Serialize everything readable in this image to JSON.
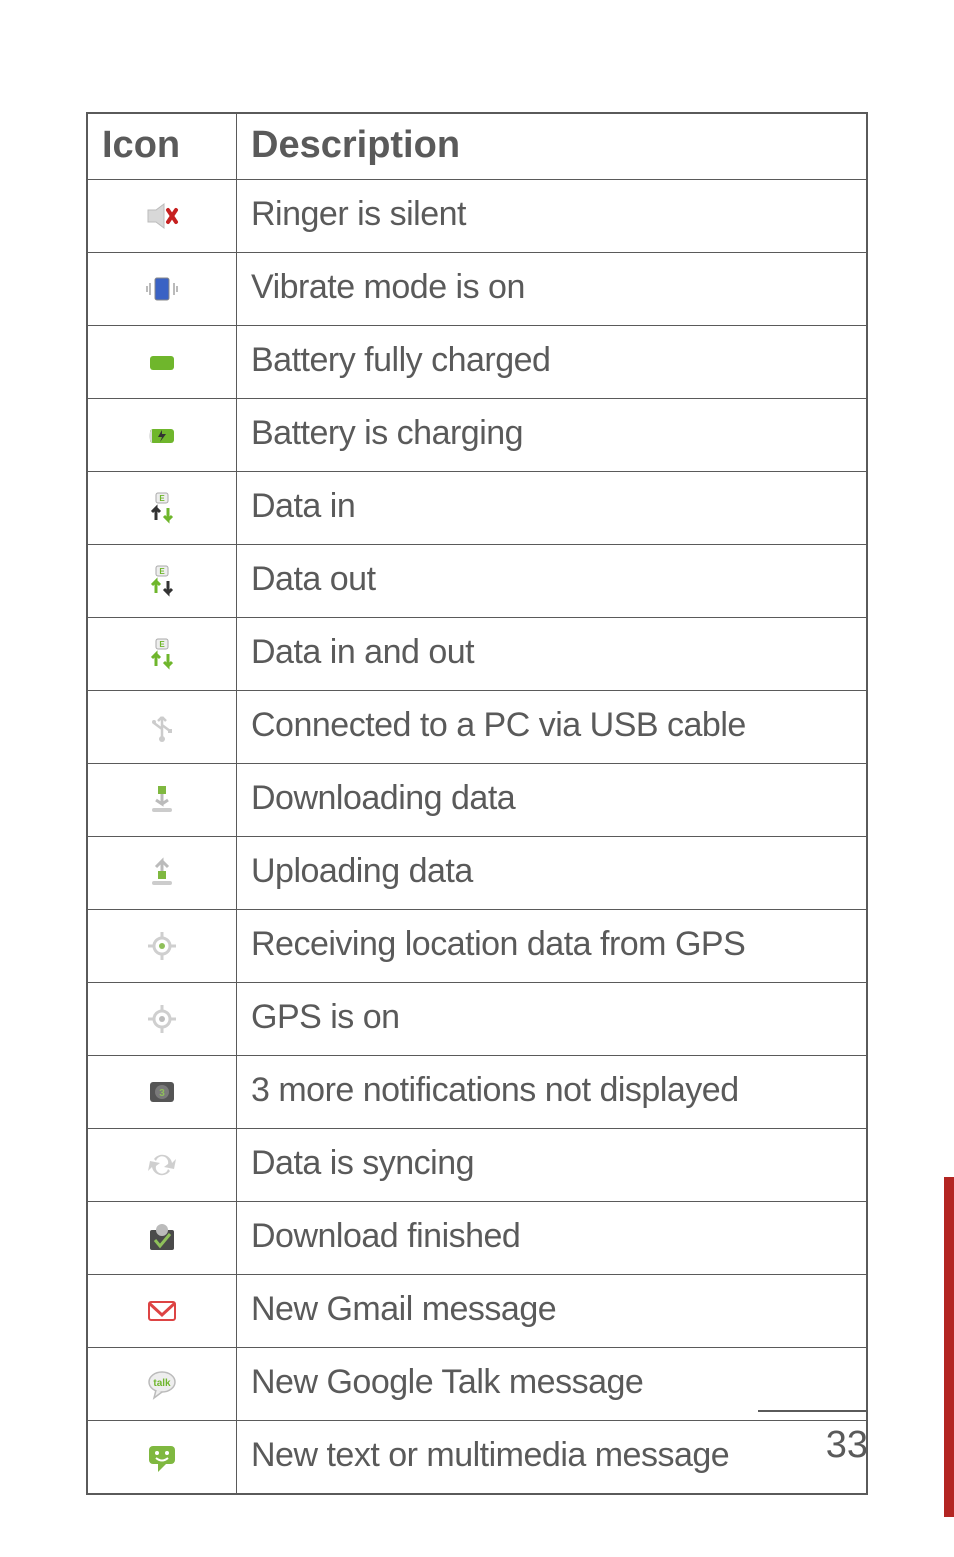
{
  "headers": {
    "icon": "Icon",
    "description": "Description"
  },
  "rows": [
    {
      "icon": "ringer-silent-icon",
      "desc": "Ringer is silent"
    },
    {
      "icon": "vibrate-icon",
      "desc": "Vibrate mode is on"
    },
    {
      "icon": "battery-full-icon",
      "desc": "Battery fully charged"
    },
    {
      "icon": "battery-charging-icon",
      "desc": "Battery is charging"
    },
    {
      "icon": "data-in-icon",
      "desc": "Data in"
    },
    {
      "icon": "data-out-icon",
      "desc": "Data out"
    },
    {
      "icon": "data-in-out-icon",
      "desc": "Data in and out"
    },
    {
      "icon": "usb-icon",
      "desc": "Connected to a PC via USB cable"
    },
    {
      "icon": "download-icon",
      "desc": "Downloading data"
    },
    {
      "icon": "upload-icon",
      "desc": "Uploading data"
    },
    {
      "icon": "gps-receiving-icon",
      "desc": "Receiving location data from GPS"
    },
    {
      "icon": "gps-on-icon",
      "desc": "GPS is on"
    },
    {
      "icon": "more-notifications-icon",
      "desc": "3 more notifications not displayed"
    },
    {
      "icon": "sync-icon",
      "desc": "Data is syncing"
    },
    {
      "icon": "download-finished-icon",
      "desc": "Download finished"
    },
    {
      "icon": "gmail-icon",
      "desc": "New Gmail message"
    },
    {
      "icon": "gtalk-icon",
      "desc": "New Google Talk message"
    },
    {
      "icon": "mms-icon",
      "desc": "New text or multimedia message"
    }
  ],
  "page_number": "33"
}
